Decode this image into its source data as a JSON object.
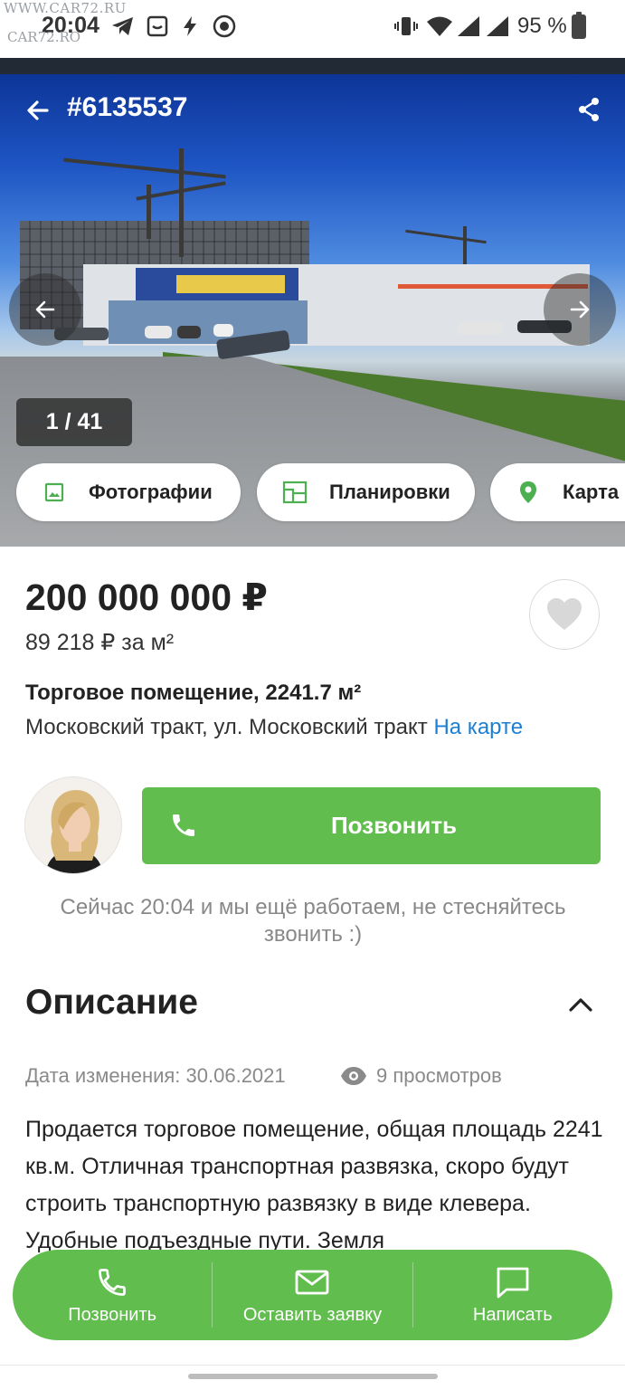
{
  "status_bar": {
    "watermark_top": "WWW.CAR72.RU",
    "watermark_bottom": "CAR72.RO",
    "time": "20:04",
    "battery": "95 %"
  },
  "header": {
    "listing_id": "#6135537"
  },
  "gallery": {
    "counter": "1 / 41",
    "tabs": [
      {
        "label": "Фотографии",
        "icon": "image-icon"
      },
      {
        "label": "Планировки",
        "icon": "floorplan-icon"
      },
      {
        "label": "Карта",
        "icon": "map-pin-icon"
      }
    ]
  },
  "listing": {
    "price": "200 000 000 ₽",
    "price_per_m2": "89 218 ₽ за м²",
    "title": "Торговое помещение, 2241.7 м²",
    "address": "Московский тракт, ул. Московский тракт",
    "map_link": "На карте"
  },
  "agent": {
    "call_label": "Позвонить",
    "work_note": "Сейчас 20:04 и мы ещё работаем, не стесняйтесь звонить :)"
  },
  "description": {
    "heading": "Описание",
    "date_changed": "Дата изменения: 30.06.2021",
    "views": "9 просмотров",
    "text": "Продается торговое помещение, общая площадь 2241 кв.м. Отличная транспортная развязка, скоро будут строить транспортную развязку в виде клевера. Удобные подъездные пути. Земля"
  },
  "bottom_bar": {
    "items": [
      {
        "label": "Позвонить",
        "icon": "phone-icon"
      },
      {
        "label": "Оставить заявку",
        "icon": "mail-icon"
      },
      {
        "label": "Написать",
        "icon": "chat-icon"
      }
    ]
  },
  "colors": {
    "accent_green": "#62bd4f",
    "link_blue": "#1d7fd1"
  }
}
